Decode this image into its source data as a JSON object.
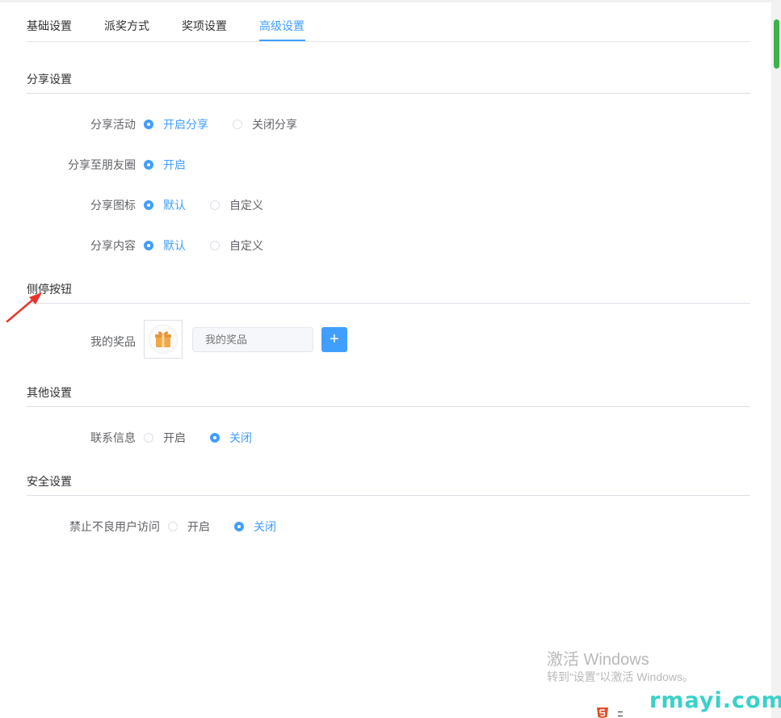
{
  "tabs": [
    {
      "label": "基础设置",
      "active": false
    },
    {
      "label": "派奖方式",
      "active": false
    },
    {
      "label": "奖项设置",
      "active": false
    },
    {
      "label": "高级设置",
      "active": true
    }
  ],
  "share": {
    "title": "分享设置",
    "activity": {
      "label": "分享活动",
      "options": [
        "开启分享",
        "关闭分享"
      ],
      "selected": "开启分享"
    },
    "moments": {
      "label": "分享至朋友圈",
      "options": [
        "开启"
      ],
      "selected": "开启"
    },
    "icon": {
      "label": "分享图标",
      "options": [
        "默认",
        "自定义"
      ],
      "selected": "默认"
    },
    "content": {
      "label": "分享内容",
      "options": [
        "默认",
        "自定义"
      ],
      "selected": "默认"
    }
  },
  "side_button": {
    "title": "侧停按钮",
    "my_prize": {
      "label": "我的奖品",
      "input_placeholder": "我的奖品",
      "add_icon": "+",
      "icon_name": "gift-icon"
    }
  },
  "other": {
    "title": "其他设置",
    "contact": {
      "label": "联系信息",
      "options": [
        "开启",
        "关闭"
      ],
      "selected": "关闭"
    }
  },
  "security": {
    "title": "安全设置",
    "block_bad_users": {
      "label": "禁止不良用户访问",
      "options": [
        "开启",
        "关闭"
      ],
      "selected": "关闭"
    }
  },
  "watermark": {
    "title": "激活 Windows",
    "subtitle": "转到“设置”以激活 Windows。",
    "brand": "rmayi.com"
  },
  "colors": {
    "accent": "#409eff",
    "arrow": "#e8352b",
    "gift": "#f0a84a",
    "brand": "#3ad1c9",
    "scroll_thumb": "#3cb44a"
  }
}
